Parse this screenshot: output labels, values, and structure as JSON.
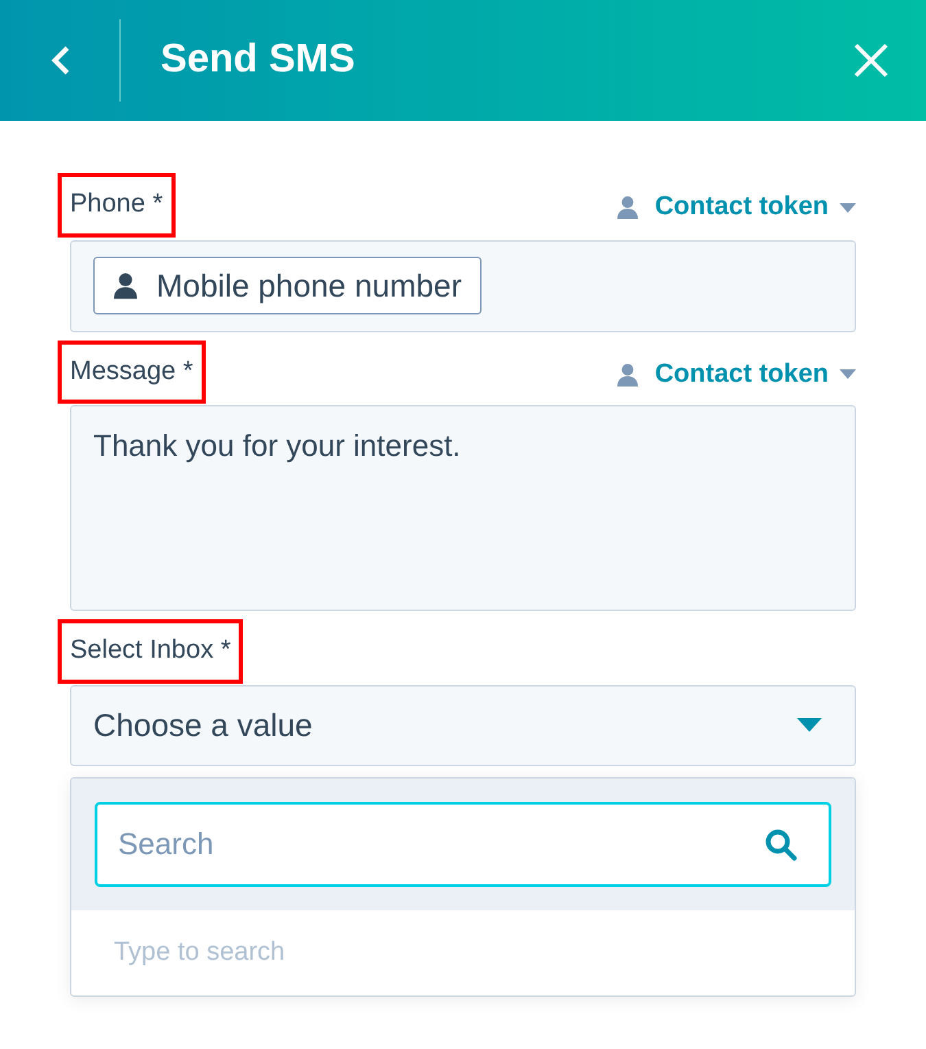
{
  "header": {
    "title": "Send SMS"
  },
  "fields": [
    {
      "kind": "token",
      "label": "Phone *",
      "highlighted": true,
      "token_link": "Contact token",
      "chip": "Mobile phone number"
    },
    {
      "kind": "textarea",
      "label": "Message *",
      "highlighted": true,
      "token_link": "Contact token",
      "value": "Thank you for your interest."
    },
    {
      "kind": "select",
      "label": "Select Inbox *",
      "highlighted": true,
      "placeholder": "Choose a value",
      "expanded": true,
      "search": {
        "placeholder": "Search"
      },
      "empty_text": "Type to search"
    }
  ]
}
